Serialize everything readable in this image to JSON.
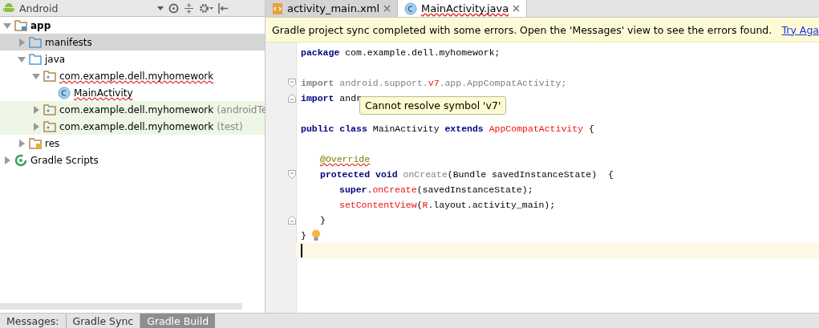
{
  "project_view": {
    "title": "Android"
  },
  "tree": [
    {
      "label": "app",
      "kind": "module",
      "bold": true,
      "expanded": true,
      "selected": false,
      "children": [
        {
          "label": "manifests",
          "kind": "folder",
          "expanded": false,
          "selected": true
        },
        {
          "label": "java",
          "kind": "folder",
          "expanded": true,
          "selected": false,
          "children": [
            {
              "label": "com.example.dell.myhomework",
              "kind": "package",
              "expanded": true,
              "selected": false,
              "error": true,
              "children": [
                {
                  "label": "MainActivity",
                  "kind": "class",
                  "selected": false,
                  "error": true
                }
              ]
            },
            {
              "label": "com.example.dell.myhomework",
              "suffix": "(androidTe",
              "kind": "package",
              "expanded": false,
              "selected": false,
              "test_scope": true
            },
            {
              "label": "com.example.dell.myhomework",
              "suffix": "(test)",
              "kind": "package",
              "expanded": false,
              "selected": false,
              "test_scope": true
            }
          ]
        },
        {
          "label": "res",
          "kind": "res",
          "expanded": false,
          "selected": false
        }
      ]
    },
    {
      "label": "Gradle Scripts",
      "kind": "gradle",
      "expanded": false,
      "selected": false
    }
  ],
  "editor_tabs": [
    {
      "label": "activity_main.xml",
      "kind": "xml",
      "selected": false
    },
    {
      "label": "MainActivity.java",
      "kind": "class",
      "selected": true,
      "error": true
    }
  ],
  "banner": {
    "text": "Gradle project sync completed with some errors. Open the 'Messages' view to see the errors found.",
    "link": "Try Aga"
  },
  "code": [
    {
      "kind": "code",
      "tokens": [
        {
          "kind": "kw",
          "text": "package"
        },
        {
          "kind": "plain",
          "text": " com.example.dell.myhomework;"
        }
      ]
    },
    {
      "kind": "blank"
    },
    {
      "kind": "code",
      "fold_start": true,
      "tokens": [
        {
          "kind": "unused-kw",
          "text": "import"
        },
        {
          "kind": "unused",
          "text": " android.support."
        },
        {
          "kind": "error",
          "text": "v7"
        },
        {
          "kind": "unused",
          "text": ".app.AppCompatActivity;"
        }
      ]
    },
    {
      "kind": "code",
      "fold_end": true,
      "tokens": [
        {
          "kind": "kw",
          "text": "import"
        },
        {
          "kind": "plain",
          "text": " andr"
        }
      ]
    },
    {
      "kind": "blank"
    },
    {
      "kind": "code",
      "tokens": [
        {
          "kind": "kw",
          "text": "public class"
        },
        {
          "kind": "plain",
          "text": " MainActivity "
        },
        {
          "kind": "kw",
          "text": "extends"
        },
        {
          "kind": "error",
          "text": " AppCompatActivity"
        },
        {
          "kind": "plain",
          "text": " {"
        }
      ],
      "children": [
        {
          "kind": "blank"
        },
        {
          "kind": "code",
          "tokens": [
            {
              "kind": "annotation",
              "text": "@Override"
            }
          ]
        },
        {
          "kind": "code",
          "fold_start": true,
          "tokens": [
            {
              "kind": "kw",
              "text": "protected void"
            },
            {
              "kind": "unused",
              "text": " onCreate"
            },
            {
              "kind": "plain",
              "text": "(Bundle savedInstanceState)  {"
            }
          ],
          "children": [
            {
              "kind": "code",
              "tokens": [
                {
                  "kind": "kw",
                  "text": "super"
                },
                {
                  "kind": "plain",
                  "text": "."
                },
                {
                  "kind": "error",
                  "text": "onCreate"
                },
                {
                  "kind": "plain",
                  "text": "(savedInstanceState);"
                }
              ]
            },
            {
              "kind": "code",
              "tokens": [
                {
                  "kind": "error",
                  "text": "setContentView"
                },
                {
                  "kind": "plain",
                  "text": "("
                },
                {
                  "kind": "error",
                  "text": "R"
                },
                {
                  "kind": "plain",
                  "text": ".layout.activity_main);"
                }
              ]
            }
          ]
        },
        {
          "kind": "code",
          "fold_end": true,
          "tokens": [
            {
              "kind": "plain",
              "text": "}"
            }
          ]
        }
      ]
    },
    {
      "kind": "code",
      "bulb": true,
      "tokens": [
        {
          "kind": "plain",
          "text": "}"
        }
      ]
    },
    {
      "kind": "caret"
    }
  ],
  "tooltip": {
    "text": "Cannot resolve symbol 'v7'"
  },
  "bottom_bar": {
    "label": "Messages:",
    "tabs": [
      {
        "label": "Gradle Sync",
        "selected": false
      },
      {
        "label": "Gradle Build",
        "selected": true
      }
    ]
  }
}
